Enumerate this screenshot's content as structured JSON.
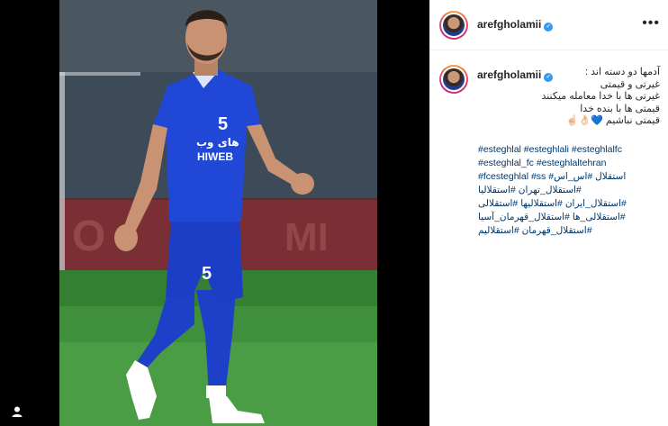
{
  "account": {
    "username": "arefgholamii",
    "verified_glyph": "✓",
    "avatar_icon": "profile-photo"
  },
  "header": {
    "more_label": "•••"
  },
  "caption": {
    "lines": [
      "آدمها دو دسته اند :",
      "غیرتی و قیمتی",
      "غیرتی ها با خدا معامله میکنند",
      "قیمتی ها با بنده خدا",
      "قیمتی نباشیم 💙👌🏻☝🏻"
    ]
  },
  "hashtags": {
    "row1": [
      "#esteghlal",
      "#esteghlali",
      "#esteghlalfc"
    ],
    "row2": [
      "#esteghlal_fc",
      "#esteghlaltehran"
    ],
    "row3": [
      "#fcesteghlal",
      "#ss",
      "#استقلال",
      "#اس_اس"
    ],
    "row4": [
      "#استقلالیا",
      "#استقلال_تهران"
    ],
    "row5": [
      "#استقلال_ایران",
      "#استقلالیها",
      "#استقلالی"
    ],
    "row6": [
      "#استقلالی_ها",
      "#استقلال_قهرمان_آسیا"
    ],
    "row7": [
      "#استقلال_قهرمان",
      "#استقلالیم"
    ]
  },
  "photo": {
    "jersey_number": "5",
    "sponsor": "HIWEB",
    "sponsor_fa": "های وب",
    "kit_color": "#1e3fc8"
  },
  "colors": {
    "link": "#00376b",
    "verified": "#3897f0",
    "text": "#262626"
  }
}
